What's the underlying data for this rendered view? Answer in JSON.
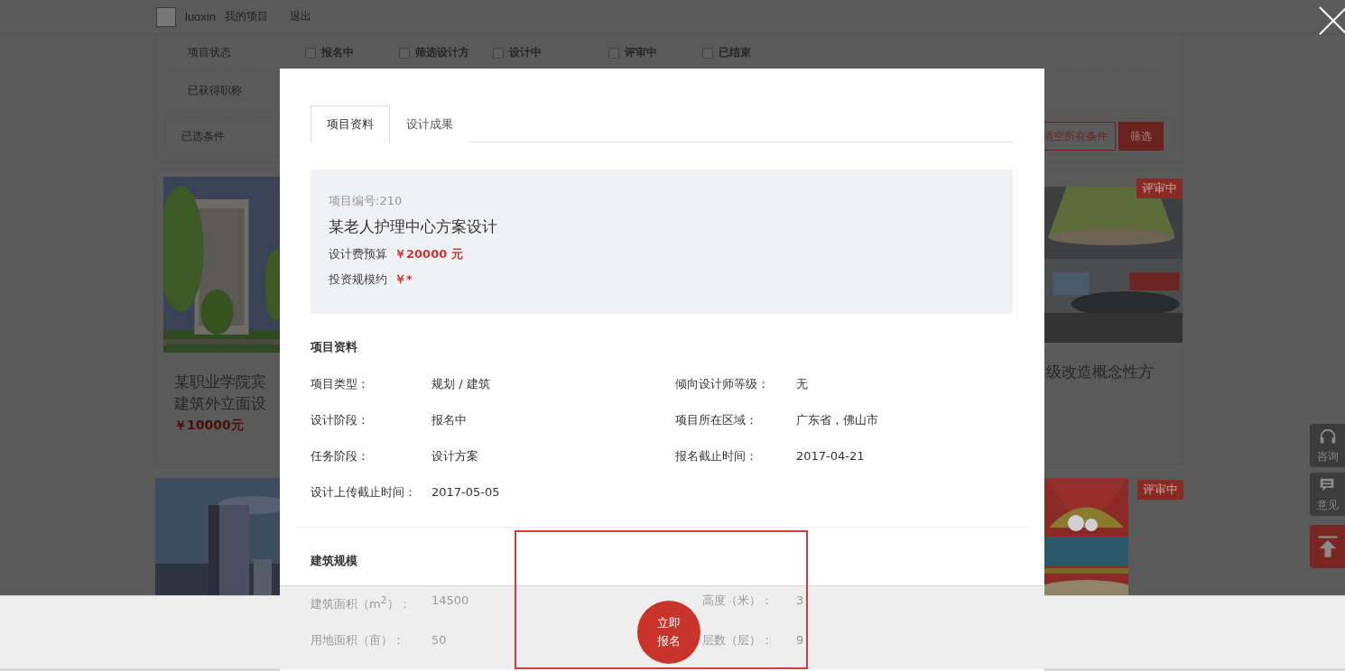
{
  "header": {
    "username": "luoxin",
    "links": [
      "我的项目",
      "退出"
    ]
  },
  "filters": {
    "status_label": "项目状态",
    "statuses": [
      {
        "label": "报名中",
        "checked": false
      },
      {
        "label": "筛选设计方",
        "checked": false
      },
      {
        "label": "设计中",
        "checked": false
      },
      {
        "label": "评审中",
        "checked": false
      },
      {
        "label": "已结束",
        "checked": false
      }
    ],
    "title_label": "已获得职称",
    "selected_label": "已选条件",
    "buttons": [
      {
        "label": "清空所有条件",
        "kind": "outline"
      },
      {
        "label": "筛选",
        "kind": "primary"
      }
    ]
  },
  "cards": [
    {
      "kind": "building",
      "title": [
        "某职业学院宾",
        "建筑外立面设"
      ],
      "price": "￥10000元"
    },
    {
      "kind": "interior",
      "badge": "评审中",
      "title": [
        "级改造概念性方"
      ]
    },
    {
      "kind": "tower"
    },
    {
      "kind": "poster",
      "badge": "评审中"
    }
  ],
  "side_buttons": [
    {
      "kind": "headset",
      "label": "咨询"
    },
    {
      "kind": "comment",
      "label": "意见"
    },
    {
      "kind": "top"
    }
  ],
  "modal": {
    "tabs": [
      {
        "label": "项目资料",
        "selected": true
      },
      {
        "label": "设计成果",
        "selected": false
      }
    ],
    "project": {
      "number": "项目编号:210",
      "title": "某老人护理中心方案设计",
      "budget_label": "设计费预算",
      "budget": "￥20000 元",
      "invest_label": "投资规模约",
      "invest": "￥*"
    },
    "info": {
      "heading": "项目资料",
      "fields": [
        {
          "label": "项目类型：",
          "value": "规划 / 建筑"
        },
        {
          "label": "倾向设计师等级：",
          "value": "无"
        },
        {
          "label": "设计阶段：",
          "value": "报名中"
        },
        {
          "label": "项目所在区域：",
          "value": "广东省，佛山市"
        },
        {
          "label": "任务阶段：",
          "value": "设计方案"
        },
        {
          "label": "报名截止时间：",
          "value": "2017-04-21"
        },
        {
          "label": "设计上传截止时间：",
          "value": "2017-05-05"
        }
      ]
    },
    "scale": {
      "heading": "建筑规模",
      "fields": [
        {
          "label": "建筑面积（m$^{2}$）：",
          "value": "14500"
        },
        {
          "label": "高度（米）：",
          "value": "3"
        },
        {
          "label": "用地面积（亩）：",
          "value": "50"
        },
        {
          "label": "层数（层）：",
          "value": "9"
        }
      ]
    },
    "apply_button": [
      "立即",
      "报名"
    ]
  }
}
